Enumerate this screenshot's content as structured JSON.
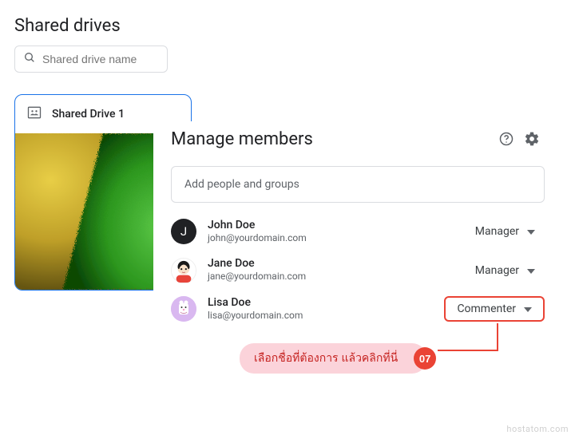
{
  "pageTitle": "Shared drives",
  "search": {
    "placeholder": "Shared drive name"
  },
  "driveCard": {
    "title": "Shared Drive 1"
  },
  "manage": {
    "title": "Manage members",
    "addPlaceholder": "Add people and groups"
  },
  "members": [
    {
      "initial": "J",
      "name": "John Doe",
      "email": "john@yourdomain.com",
      "role": "Manager"
    },
    {
      "initial": "",
      "name": "Jane Doe",
      "email": "jane@yourdomain.com",
      "role": "Manager"
    },
    {
      "initial": "",
      "name": "Lisa Doe",
      "email": "lisa@yourdomain.com",
      "role": "Commenter"
    }
  ],
  "callout": {
    "text": "เลือกชื่อที่ต้องการ แล้วคลิกที่นี่",
    "step": "07"
  },
  "watermark": "hostatom.com"
}
